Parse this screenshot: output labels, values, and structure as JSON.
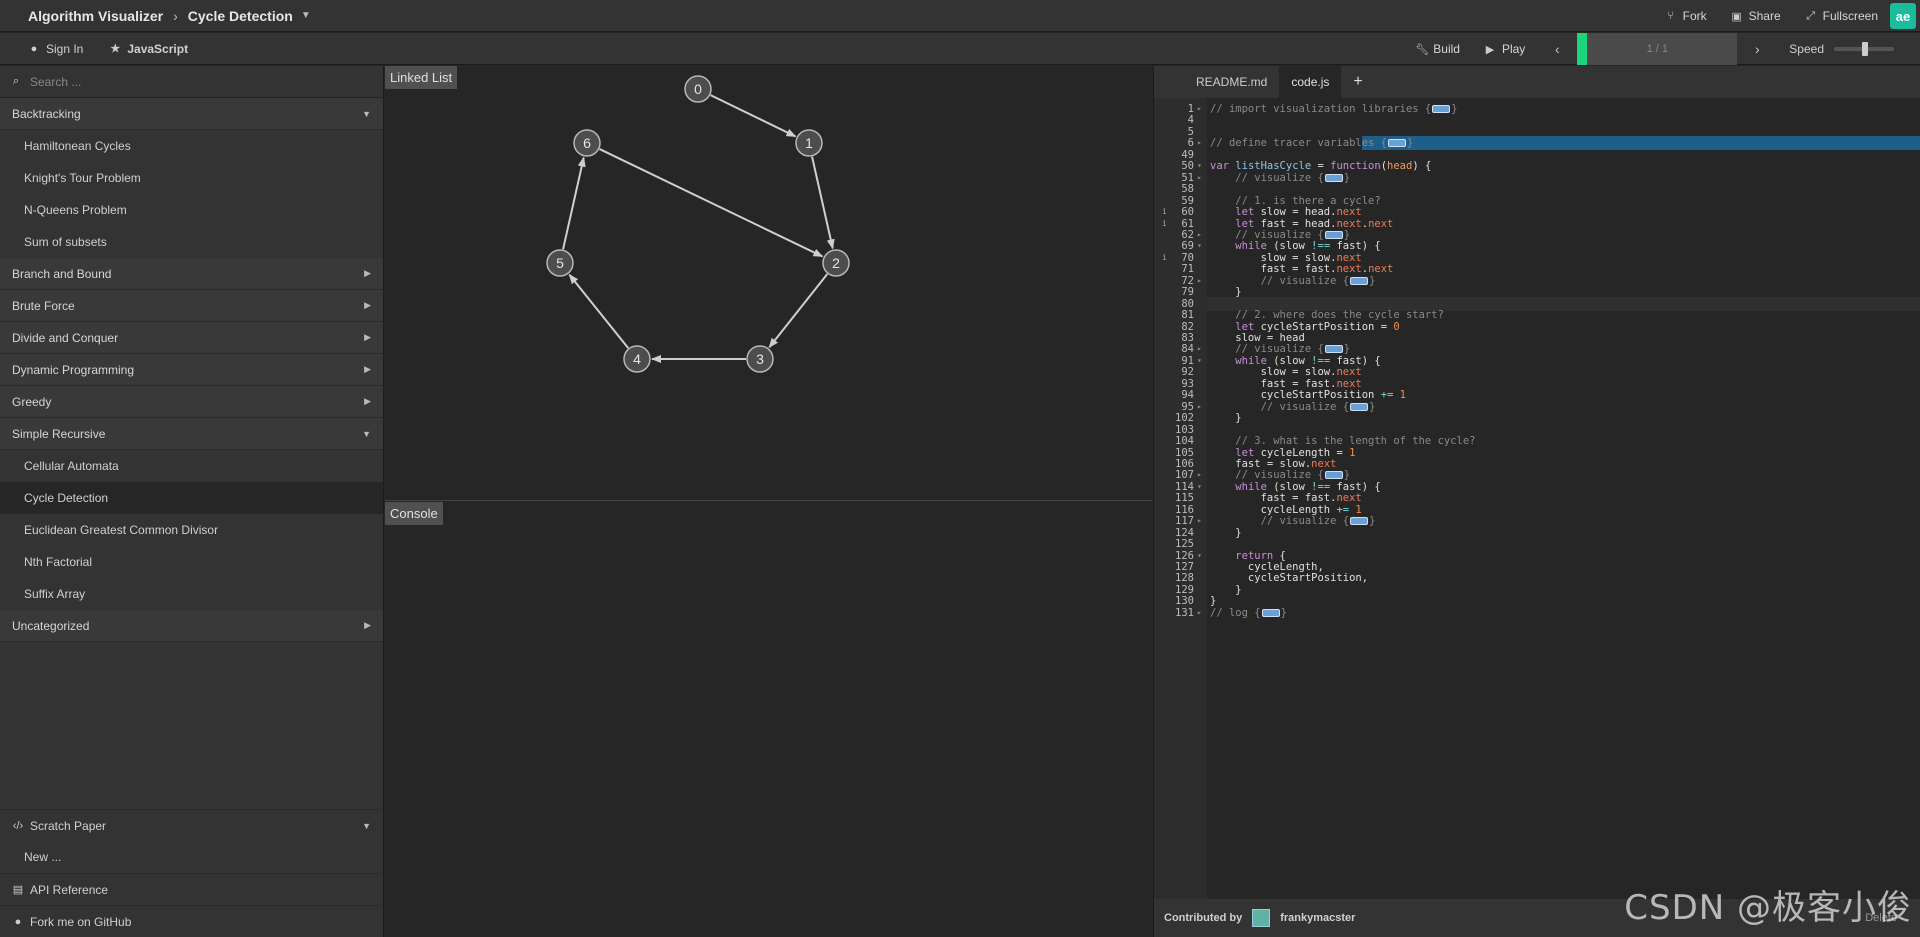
{
  "header": {
    "app_title": "Algorithm Visualizer",
    "page_title": "Cycle Detection",
    "fork": "Fork",
    "share": "Share",
    "fullscreen": "Fullscreen",
    "badge": "ae"
  },
  "toolbar": {
    "sign_in": "Sign In",
    "language": "JavaScript",
    "build": "Build",
    "play": "Play",
    "progress": "1 / 1",
    "speed": "Speed"
  },
  "sidebar": {
    "search_placeholder": "Search ...",
    "categories": [
      {
        "label": "Backtracking",
        "items": [
          "Hamiltonean Cycles",
          "Knight's Tour Problem",
          "N-Queens Problem",
          "Sum of subsets"
        ]
      },
      {
        "label": "Branch and Bound"
      },
      {
        "label": "Brute Force"
      },
      {
        "label": "Divide and Conquer"
      },
      {
        "label": "Dynamic Programming"
      },
      {
        "label": "Greedy"
      },
      {
        "label": "Simple Recursive",
        "items": [
          "Cellular Automata",
          "Cycle Detection",
          "Euclidean Greatest Common Divisor",
          "Nth Factorial",
          "Suffix Array"
        ]
      },
      {
        "label": "Uncategorized"
      }
    ],
    "scratch_paper": "Scratch Paper",
    "new_item": "New ...",
    "api_reference": "API Reference",
    "fork_github": "Fork me on GitHub"
  },
  "graph": {
    "label": "Linked List",
    "nodes": [
      "0",
      "1",
      "2",
      "3",
      "4",
      "5",
      "6"
    ]
  },
  "console": {
    "label": "Console"
  },
  "editor": {
    "tabs": [
      "README.md",
      "code.js"
    ],
    "line_numbers": [
      "1",
      "4",
      "5",
      "6",
      "49",
      "50",
      "51",
      "58",
      "59",
      "60",
      "61",
      "62",
      "69",
      "70",
      "71",
      "72",
      "79",
      "80",
      "81",
      "82",
      "83",
      "84",
      "91",
      "92",
      "93",
      "94",
      "95",
      "102",
      "103",
      "104",
      "105",
      "106",
      "107",
      "114",
      "115",
      "116",
      "117",
      "124",
      "125",
      "126",
      "127",
      "128",
      "129",
      "130",
      "131"
    ],
    "lines": [
      "// import visualization libraries {",
      "",
      "",
      "// define tracer variables {",
      "",
      "var listHasCycle = function(head) {",
      "    // visualize {",
      "",
      "    // 1. is there a cycle?",
      "    let slow = head.next",
      "    let fast = head.next.next",
      "    // visualize {",
      "    while (slow !== fast) {",
      "        slow = slow.next",
      "        fast = fast.next.next",
      "        // visualize {",
      "    }",
      "",
      "    // 2. where does the cycle start?",
      "    let cycleStartPosition = 0",
      "    slow = head",
      "    // visualize {",
      "    while (slow !== fast) {",
      "        slow = slow.next",
      "        fast = fast.next",
      "        cycleStartPosition += 1",
      "        // visualize {",
      "    }",
      "",
      "    // 3. what is the length of the cycle?",
      "    let cycleLength = 1",
      "    fast = slow.next",
      "    // visualize {",
      "    while (slow !== fast) {",
      "        fast = fast.next",
      "        cycleLength += 1",
      "        // visualize {",
      "    }",
      "",
      "    return {",
      "      cycleLength,",
      "      cycleStartPosition,",
      "    }",
      "}",
      "// log {"
    ],
    "contributed_by": "Contributed by",
    "contributor": "frankymacster",
    "delete": "Delete"
  },
  "watermark": "CSDN @极客小俊",
  "colors": {
    "accent": "#1ad67a",
    "selection": "#1d5f8a",
    "badge": "#1abc9c"
  }
}
